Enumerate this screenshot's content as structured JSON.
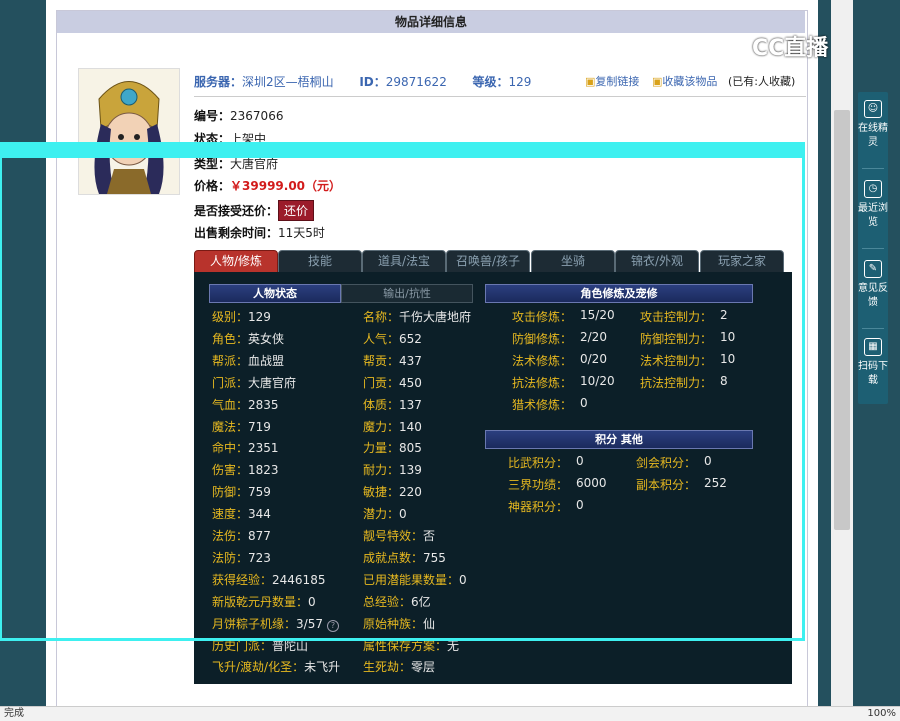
{
  "page_title": "物品详细信息",
  "header": {
    "server_label": "服务器：",
    "server_value": "深圳2区—梧桐山",
    "id_label": "ID：",
    "id_value": "29871622",
    "level_label": "等级：",
    "level_value": "129",
    "copy_link": "复制链接",
    "favorite": "收藏该物品",
    "favorited_count": "(已有:人收藏)"
  },
  "item": {
    "number_label": "编号：",
    "number_value": "2367066",
    "status_label": "状态：",
    "status_value": "上架中",
    "type_label": "类型：",
    "type_value": "大唐官府",
    "price_label": "价格：",
    "price_value": "￥39999.00（元）",
    "counter_label": "是否接受还价：",
    "counter_button": "还价",
    "remaining_label": "出售剩余时间：",
    "remaining_value": "11天5时"
  },
  "tabs": [
    "人物/修炼",
    "技能",
    "道具/法宝",
    "召唤兽/孩子",
    "坐骑",
    "锦衣/外观",
    "玩家之家"
  ],
  "panel": {
    "subtabs": [
      "人物状态",
      "输出/抗性"
    ],
    "left_col1": [
      [
        "级别：",
        "129"
      ],
      [
        "角色：",
        "英女侠"
      ],
      [
        "帮派：",
        "血战盟"
      ],
      [
        "门派：",
        "大唐官府"
      ],
      [
        "气血：",
        "2835"
      ],
      [
        "魔法：",
        "719"
      ],
      [
        "命中：",
        "2351"
      ],
      [
        "伤害：",
        "1823"
      ],
      [
        "防御：",
        "759"
      ],
      [
        "速度：",
        "344"
      ],
      [
        "法伤：",
        "877"
      ],
      [
        "法防：",
        "723"
      ],
      [
        "获得经验：",
        "2446185"
      ],
      [
        "新版乾元丹数量：",
        "0"
      ],
      [
        "月饼粽子机缘：",
        "3/57"
      ],
      [
        "历史门派：",
        "普陀山"
      ],
      [
        "飞升/渡劫/化圣：",
        "未飞升"
      ]
    ],
    "left_col2": [
      [
        "名称：",
        "千伤大唐地府"
      ],
      [
        "人气：",
        "652"
      ],
      [
        "帮贡：",
        "437"
      ],
      [
        "门贡：",
        "450"
      ],
      [
        "体质：",
        "137"
      ],
      [
        "魔力：",
        "140"
      ],
      [
        "力量：",
        "805"
      ],
      [
        "耐力：",
        "139"
      ],
      [
        "敏捷：",
        "220"
      ],
      [
        "潜力：",
        "0"
      ],
      [
        "靓号特效：",
        "否"
      ],
      [
        "成就点数：",
        "755"
      ],
      [
        "已用潜能果数量：",
        "0"
      ],
      [
        "总经验：",
        "6亿"
      ],
      [
        "原始种族：",
        "仙"
      ],
      [
        "属性保存方案：",
        "无"
      ],
      [
        "生死劫：",
        "零层"
      ]
    ],
    "cultivation_title": "角色修炼及宠修",
    "cultivation": [
      [
        "攻击修炼：",
        "15/20",
        "攻击控制力：",
        "2"
      ],
      [
        "防御修炼：",
        "2/20",
        "防御控制力：",
        "10"
      ],
      [
        "法术修炼：",
        "0/20",
        "法术控制力：",
        "10"
      ],
      [
        "抗法修炼：",
        "10/20",
        "抗法控制力：",
        "8"
      ],
      [
        "猎术修炼：",
        "0",
        "",
        ""
      ]
    ],
    "points_title": "积分 其他",
    "points": [
      [
        "比武积分：",
        "0",
        "剑会积分：",
        "0"
      ],
      [
        "三界功绩：",
        "6000",
        "副本积分：",
        "252"
      ],
      [
        "神器积分：",
        "0",
        "",
        ""
      ]
    ]
  },
  "side_panel": [
    {
      "icon": "smiley-icon",
      "text": "在线精灵"
    },
    {
      "icon": "clock-icon",
      "text": "最近浏览"
    },
    {
      "icon": "edit-icon",
      "text": "意见反馈"
    },
    {
      "icon": "qr-icon",
      "text": "扫码下载"
    }
  ],
  "logo_text": "CC直播",
  "status_bar": {
    "left": "完成",
    "zoom": "100%"
  },
  "colors": {
    "accent_red": "#b8332c",
    "panel_bg": "#0c1f28",
    "label_gold": "#e6b820",
    "cyan_frame": "#3ef0f0"
  }
}
